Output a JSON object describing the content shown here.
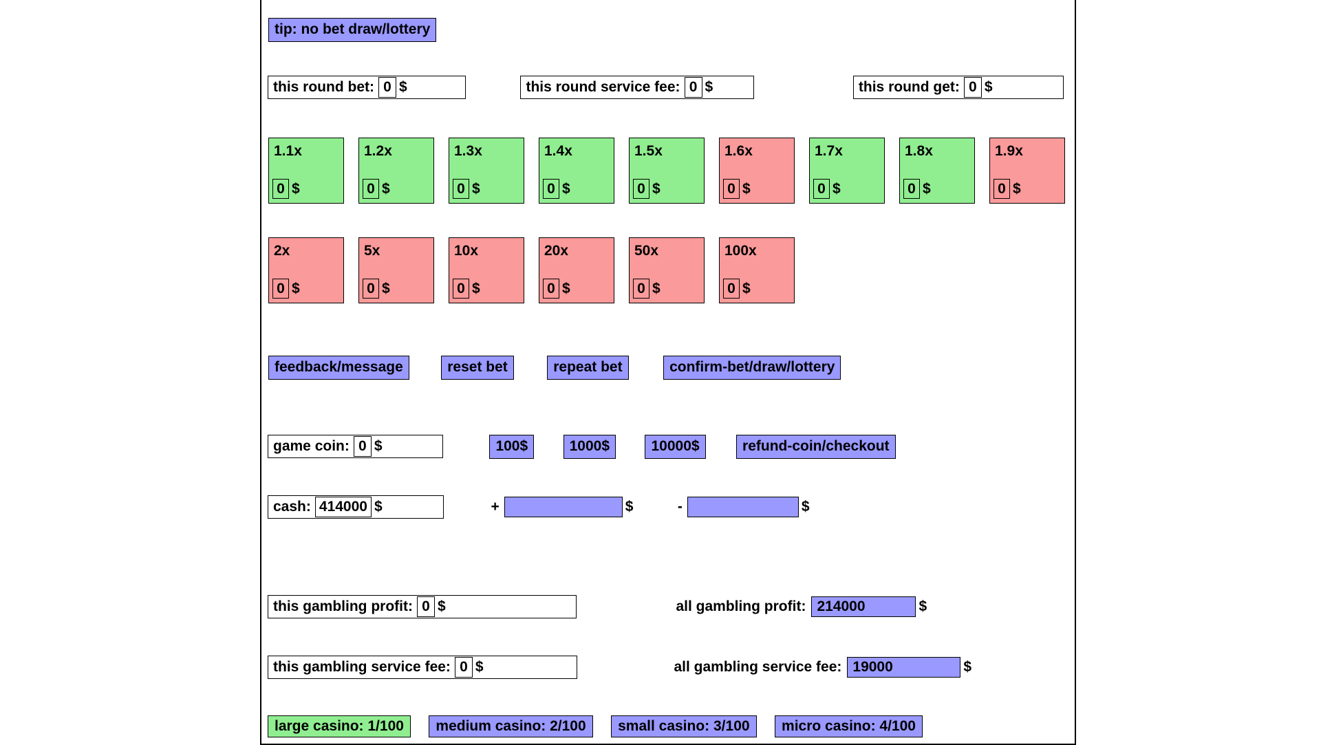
{
  "colors": {
    "accent_blue": "#9999ff",
    "win_green": "#90ee90",
    "lose_red": "#fa9a9a",
    "border": "#000000",
    "background": "#ffffff"
  },
  "tip": {
    "label": "tip: no bet draw/lottery"
  },
  "round_summary": [
    {
      "label": "this round bet:",
      "value": "0",
      "unit": "$"
    },
    {
      "label": "this round service fee:",
      "value": "0",
      "unit": "$"
    },
    {
      "label": "this round get:",
      "value": "0",
      "unit": "$"
    }
  ],
  "bet_tiles_row1": [
    {
      "multiplier": "1.1x",
      "bet": "0",
      "unit": "$",
      "state": "green"
    },
    {
      "multiplier": "1.2x",
      "bet": "0",
      "unit": "$",
      "state": "green"
    },
    {
      "multiplier": "1.3x",
      "bet": "0",
      "unit": "$",
      "state": "green"
    },
    {
      "multiplier": "1.4x",
      "bet": "0",
      "unit": "$",
      "state": "green"
    },
    {
      "multiplier": "1.5x",
      "bet": "0",
      "unit": "$",
      "state": "green"
    },
    {
      "multiplier": "1.6x",
      "bet": "0",
      "unit": "$",
      "state": "red"
    },
    {
      "multiplier": "1.7x",
      "bet": "0",
      "unit": "$",
      "state": "green"
    },
    {
      "multiplier": "1.8x",
      "bet": "0",
      "unit": "$",
      "state": "green"
    },
    {
      "multiplier": "1.9x",
      "bet": "0",
      "unit": "$",
      "state": "red"
    }
  ],
  "bet_tiles_row2": [
    {
      "multiplier": "2x",
      "bet": "0",
      "unit": "$",
      "state": "red"
    },
    {
      "multiplier": "5x",
      "bet": "0",
      "unit": "$",
      "state": "red"
    },
    {
      "multiplier": "10x",
      "bet": "0",
      "unit": "$",
      "state": "red"
    },
    {
      "multiplier": "20x",
      "bet": "0",
      "unit": "$",
      "state": "red"
    },
    {
      "multiplier": "50x",
      "bet": "0",
      "unit": "$",
      "state": "red"
    },
    {
      "multiplier": "100x",
      "bet": "0",
      "unit": "$",
      "state": "red"
    }
  ],
  "actions": {
    "feedback": "feedback/message",
    "reset_bet": "reset bet",
    "repeat_bet": "repeat bet",
    "confirm_bet": "confirm-bet/draw/lottery"
  },
  "coin": {
    "label": "game coin:",
    "value": "0",
    "unit": "$",
    "buy_100": "100$",
    "buy_1000": "1000$",
    "buy_10000": "10000$",
    "refund": "refund-coin/checkout"
  },
  "cash": {
    "label": "cash:",
    "value": "414000",
    "unit": "$",
    "add_sign": "+",
    "add_value": "",
    "add_unit": "$",
    "sub_sign": "-",
    "sub_value": "",
    "sub_unit": "$"
  },
  "stats": {
    "this_profit_label": "this gambling profit:",
    "this_profit_value": "0",
    "this_profit_unit": "$",
    "all_profit_label": "all gambling profit:",
    "all_profit_value": "214000",
    "all_profit_unit": "$",
    "this_fee_label": "this gambling service fee:",
    "this_fee_value": "0",
    "this_fee_unit": "$",
    "all_fee_label": "all gambling service fee:",
    "all_fee_value": "19000",
    "all_fee_unit": "$"
  },
  "casinos": [
    {
      "label": "large casino: 1/100",
      "active": true
    },
    {
      "label": "medium casino: 2/100",
      "active": false
    },
    {
      "label": "small casino: 3/100",
      "active": false
    },
    {
      "label": "micro casino: 4/100",
      "active": false
    }
  ]
}
